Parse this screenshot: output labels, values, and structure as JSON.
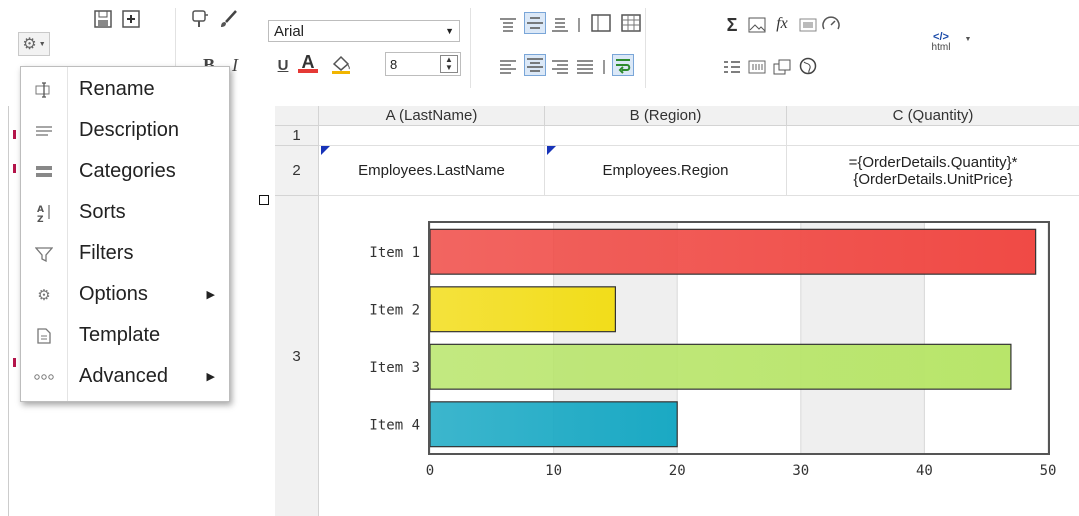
{
  "toolbar": {
    "font_family": "Arial",
    "font_size": "8",
    "html_label": "html",
    "sum_glyph": "Σ",
    "fx_glyph": "fx",
    "bold_glyph": "B",
    "italic_glyph": "I",
    "underline_glyph": "U",
    "font_color_glyph": "A",
    "font_color": "#e53935"
  },
  "menu": {
    "items": [
      {
        "label": "Rename",
        "icon": "rename-icon"
      },
      {
        "label": "Description",
        "icon": "description-icon"
      },
      {
        "label": "Categories",
        "icon": "categories-icon"
      },
      {
        "label": "Sorts",
        "icon": "sort-az-icon"
      },
      {
        "label": "Filters",
        "icon": "filter-icon"
      },
      {
        "label": "Options",
        "icon": "options-icon",
        "submenu": true
      },
      {
        "label": "Template",
        "icon": "template-icon"
      },
      {
        "label": "Advanced",
        "icon": "advanced-icon",
        "submenu": true
      }
    ]
  },
  "grid": {
    "columns": [
      "A (LastName)",
      "B (Region)",
      "C (Quantity)"
    ],
    "rows": [
      "1",
      "2",
      "3"
    ],
    "row2": {
      "a": "Employees.LastName",
      "b": "Employees.Region",
      "c_line1": "={OrderDetails.Quantity}*",
      "c_line2": "{OrderDetails.UnitPrice}"
    }
  },
  "chart_data": {
    "type": "bar",
    "orientation": "horizontal",
    "categories": [
      "Item 1",
      "Item 2",
      "Item 3",
      "Item 4"
    ],
    "values": [
      49,
      15,
      47,
      20
    ],
    "colors": [
      "#f04a45",
      "#f2dd1a",
      "#b8e56a",
      "#1aa9c4"
    ],
    "xticks": [
      "0",
      "10",
      "20",
      "30",
      "40",
      "50"
    ],
    "xlim": [
      0,
      50
    ],
    "grid": true
  }
}
